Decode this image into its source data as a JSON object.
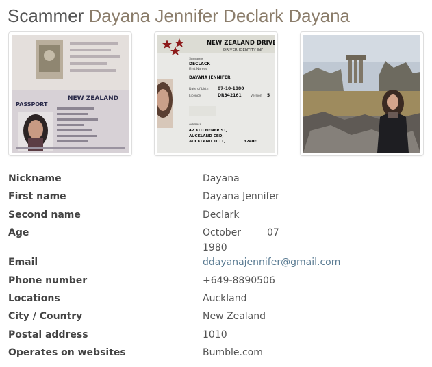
{
  "header": {
    "prefix": "Scammer",
    "name": "Dayana Jennifer Declark Dayana"
  },
  "photos": [
    {
      "caption": "passport",
      "country": "NEW ZEALAND",
      "doc_type": "PASSPORT"
    },
    {
      "caption": "driver licence",
      "header": "NEW ZEALAND DRIVER",
      "subheader": "DRIVER IDENTITY INF",
      "surname_label": "Surname",
      "surname": "DECLACK",
      "first_names_label": "First Names",
      "first_names": "DAYANA JENNIFER",
      "dob_label": "Date of birth",
      "dob": "07-10-1980",
      "licence_label": "Licence",
      "licence_no": "DR342161",
      "version_label": "Version",
      "version_no": "5",
      "address_label": "Address",
      "address_1": "42 KITCHENER ST,",
      "address_2": "AUCKLAND CBD,",
      "address_3": "AUCKLAND 1011,",
      "address_code": "3240F"
    },
    {
      "caption": "ruins photo"
    }
  ],
  "details": {
    "nickname_label": "Nickname",
    "nickname": "Dayana",
    "first_name_label": "First name",
    "first_name": "Dayana Jennifer",
    "second_name_label": "Second name",
    "second_name": "Declark",
    "age_label": "Age",
    "age_month": "October",
    "age_day": "07",
    "age_year": "1980",
    "email_label": "Email",
    "email": "ddayanajennifer@gmail.com",
    "phone_label": "Phone number",
    "phone": "+649-8890506",
    "locations_label": "Locations",
    "locations": "Auckland",
    "city_country_label": "City / Country",
    "city_country": "New Zealand",
    "postal_label": "Postal address",
    "postal": "1010",
    "websites_label": "Operates on websites",
    "websites": "Bumble.com"
  },
  "colors": {
    "title_gray": "#555555",
    "name_accent": "#8b7d6b",
    "link_blue": "#5b7c93"
  }
}
